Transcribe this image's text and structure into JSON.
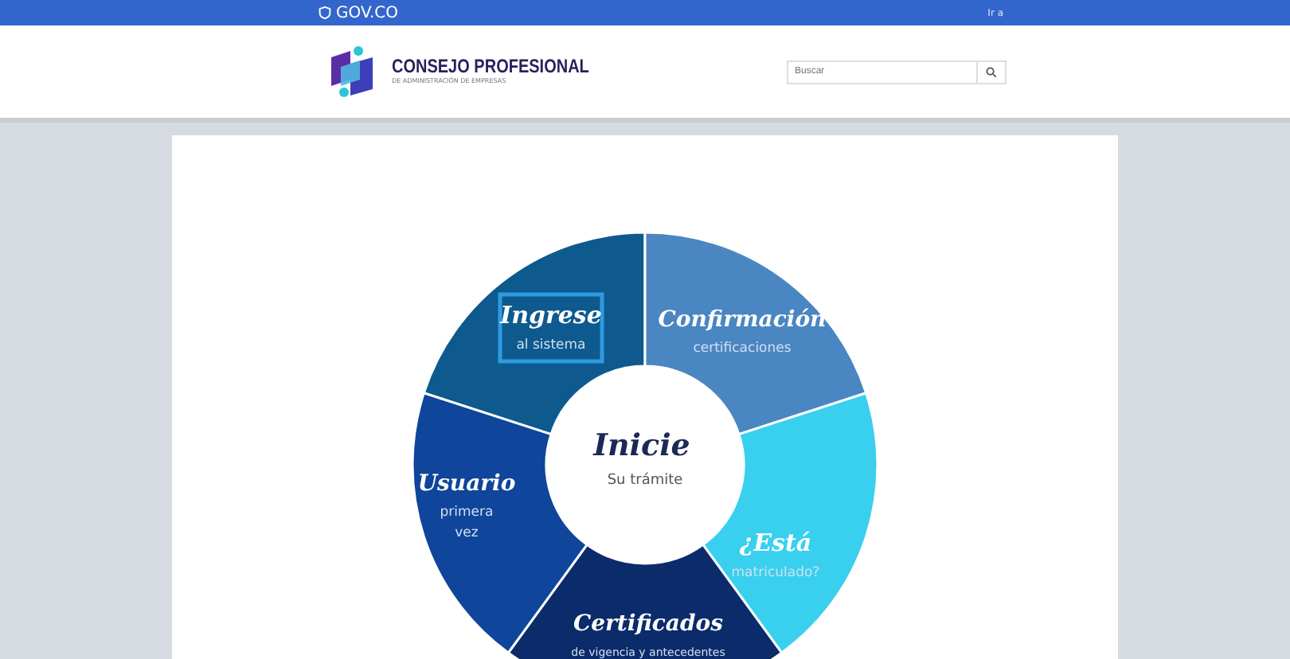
{
  "top_bar": {
    "brand": "GOV.CO",
    "link": "Ir a"
  },
  "header": {
    "logo_title": "CONSEJO PROFESIONAL",
    "logo_subtitle": "DE ADMINISTRACIÓN DE EMPRESAS",
    "search": {
      "placeholder": "Buscar"
    }
  },
  "wheel": {
    "center_title": "Inicie",
    "center_subtitle": "Su trámite",
    "segments": [
      {
        "title": "Ingrese",
        "subtitle": [
          "al sistema"
        ],
        "color": "#0e5a8e",
        "selected": true
      },
      {
        "title": "Confirmación",
        "subtitle": [
          "certificaciones"
        ],
        "color": "#4a86c2",
        "selected": false
      },
      {
        "title": "¿Está",
        "subtitle": [
          "matriculado?"
        ],
        "color": "#38d0ee",
        "selected": false
      },
      {
        "title": "Certificados",
        "subtitle": [
          "de vigencia y antecedentes"
        ],
        "color": "#0b2b6b",
        "selected": false
      },
      {
        "title": "Usuario",
        "subtitle": [
          "primera",
          "vez"
        ],
        "color": "#0f459b",
        "selected": false
      }
    ]
  }
}
